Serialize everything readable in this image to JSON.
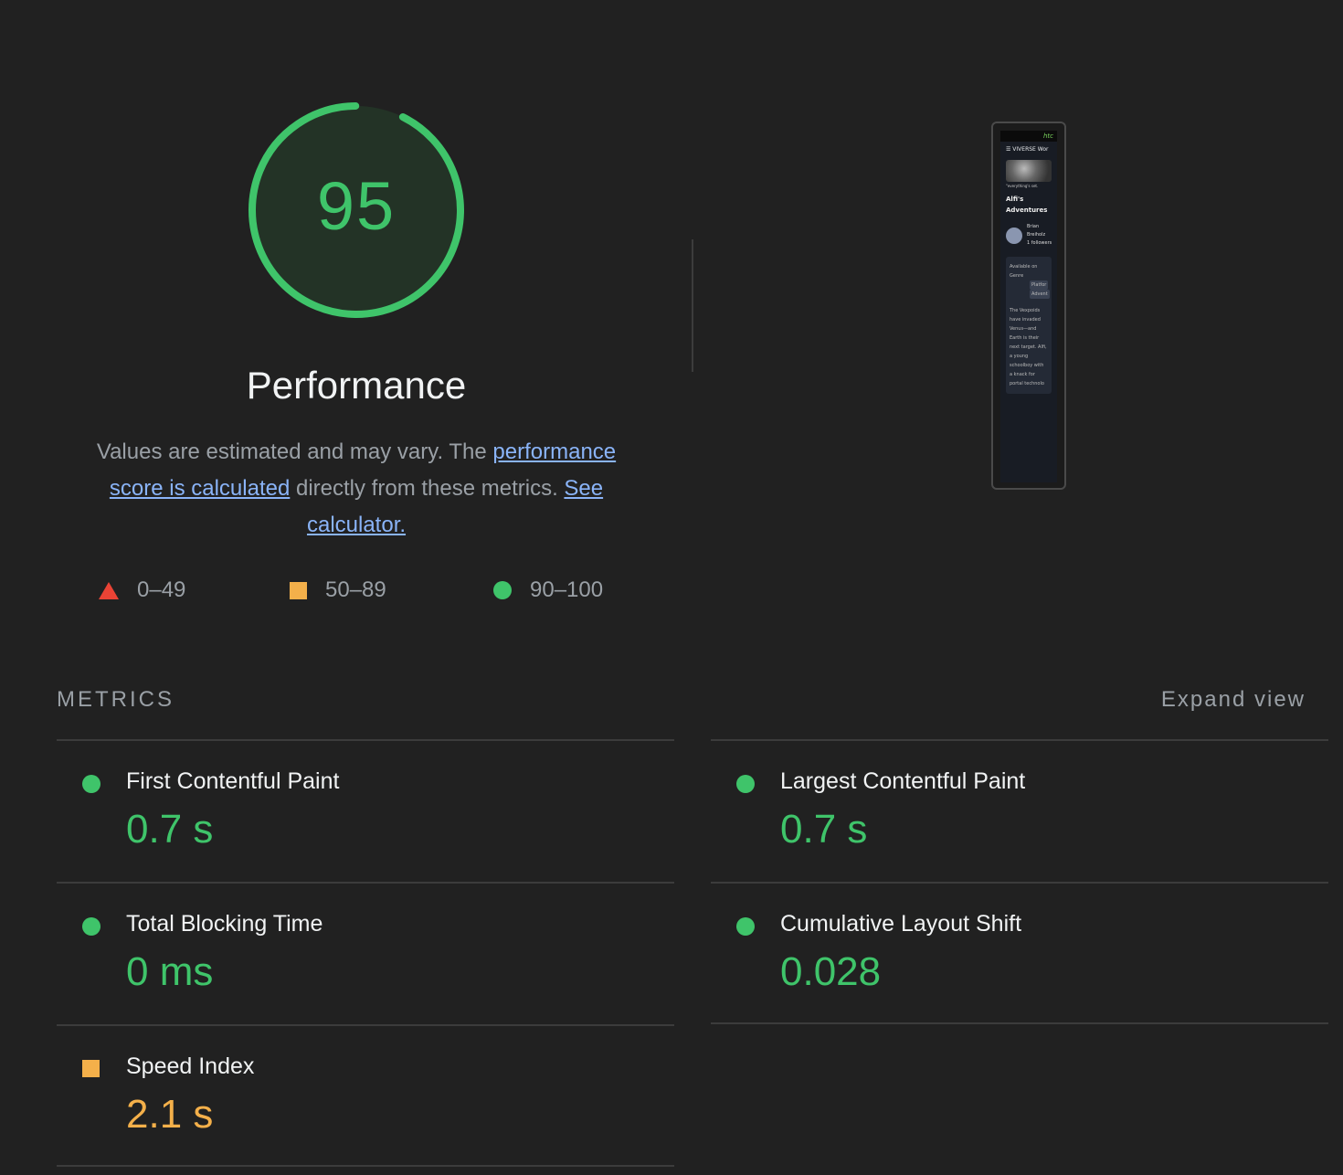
{
  "gauge": {
    "score": "95",
    "score_fraction": 0.95,
    "title": "Performance",
    "color": "#3fc46a"
  },
  "description": {
    "text_1": "Values are estimated and may vary. The ",
    "link_1": "performance score is calculated",
    "text_2": " directly from these metrics. ",
    "link_2": "See calculator."
  },
  "legend": [
    {
      "range": "0–49",
      "shape": "triangle",
      "color": "#ea4335"
    },
    {
      "range": "50–89",
      "shape": "square",
      "color": "#f4b04a"
    },
    {
      "range": "90–100",
      "shape": "circle",
      "color": "#3fc46a"
    }
  ],
  "thumbnail": {
    "brand": "htc",
    "nav": "VIVERSE Wor",
    "caption": "\"everything's set.",
    "title": "Alfi's Adventures",
    "author_line1": "Brian",
    "author_line2": "Breiholz",
    "author_line3": "1 followers",
    "available": "Available on",
    "genre_label": "Genre",
    "genre_chip1": "Platfor",
    "genre_chip2": "Advent",
    "description": "The Vexpoids have invaded Venus—and Earth is their next target. Alfi, a young schoolboy with a knack for portal technolo"
  },
  "metrics": {
    "header": "METRICS",
    "expand_label": "Expand view",
    "items": [
      {
        "label": "First Contentful Paint",
        "value": "0.7 s",
        "status": "pass"
      },
      {
        "label": "Largest Contentful Paint",
        "value": "0.7 s",
        "status": "pass"
      },
      {
        "label": "Total Blocking Time",
        "value": "0 ms",
        "status": "pass"
      },
      {
        "label": "Cumulative Layout Shift",
        "value": "0.028",
        "status": "pass"
      },
      {
        "label": "Speed Index",
        "value": "2.1 s",
        "status": "average"
      }
    ]
  }
}
